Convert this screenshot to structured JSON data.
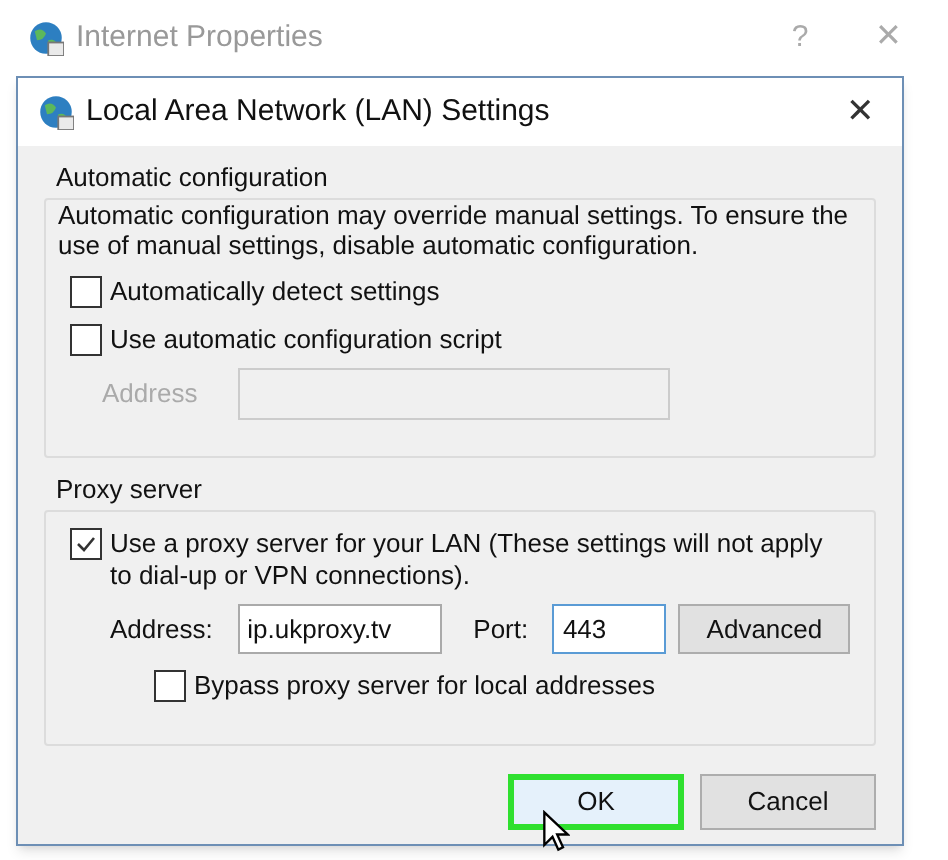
{
  "parent_window": {
    "title": "Internet Properties",
    "help": "?",
    "close": "✕"
  },
  "dialog": {
    "title": "Local Area Network (LAN) Settings",
    "close": "✕"
  },
  "automatic_configuration": {
    "heading": "Automatic configuration",
    "description": "Automatic configuration may override manual settings.  To ensure the use of manual settings, disable automatic configuration.",
    "checkboxes": [
      {
        "label": "Automatically detect settings",
        "checked": false
      },
      {
        "label": "Use automatic configuration script",
        "checked": false
      }
    ],
    "address": {
      "label": "Address",
      "disabled": true
    }
  },
  "proxy_server": {
    "heading": "Proxy server",
    "use_proxy": {
      "label": "Use a proxy server for your LAN (These settings will not apply to dial-up or VPN connections).",
      "checked": true
    },
    "address": {
      "label": "Address:",
      "value": "ip.ukproxy.tv"
    },
    "port": {
      "label": "Port:",
      "value": "443"
    },
    "advanced_button": "Advanced",
    "bypass": {
      "label": "Bypass proxy server for local addresses",
      "checked": false
    }
  },
  "buttons": [
    {
      "label": "OK",
      "highlighted": true
    },
    {
      "label": "Cancel",
      "highlighted": false
    }
  ]
}
